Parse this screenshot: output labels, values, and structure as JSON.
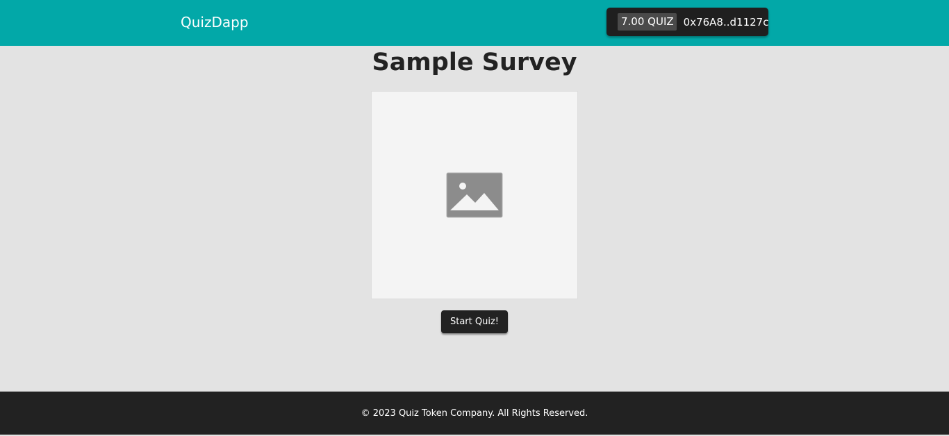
{
  "header": {
    "brand": "QuizDapp",
    "wallet": {
      "balance": "7.00 QUIZ",
      "address": "0x76A8..d1127c"
    }
  },
  "main": {
    "title": "Sample Survey",
    "image": {
      "icon": "image-placeholder-icon"
    },
    "start_button_label": "Start Quiz!"
  },
  "footer": {
    "copyright": "© 2023 Quiz Token Company. All Rights Reserved."
  },
  "colors": {
    "header_bg": "#02a8a8",
    "page_bg": "#e3e3e3",
    "dark": "#222222"
  }
}
